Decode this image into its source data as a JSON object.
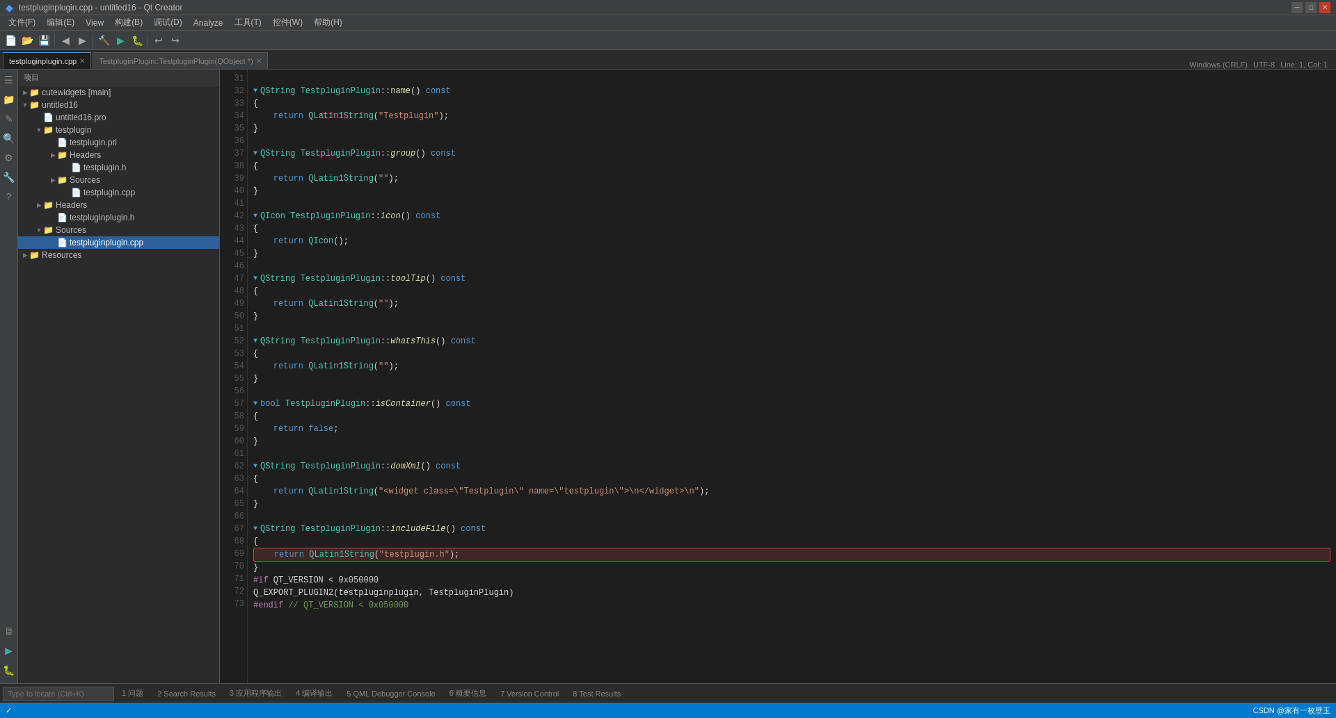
{
  "titlebar": {
    "title": "testpluginplugin.cpp - untitled16 - Qt Creator",
    "controls": [
      "—",
      "□",
      "✕"
    ]
  },
  "menubar": {
    "items": [
      "文件(F)",
      "编辑(E)",
      "View",
      "构建(B)",
      "调试(D)",
      "Analyze",
      "工具(T)",
      "控件(W)",
      "帮助(H)"
    ]
  },
  "tabs": {
    "active_tab": "testpluginplugin.cpp",
    "tabs": [
      {
        "label": "testpluginplugin.cpp",
        "active": true
      },
      {
        "label": "TestpluginPlugin::TestpluginPlugin(QObject *)",
        "active": false
      }
    ],
    "right_info": "Windows (CRLF)",
    "line_col": "Line: 1, Col: 1"
  },
  "project_tree": {
    "header": "项目",
    "items": [
      {
        "level": 0,
        "arrow": "▶",
        "icon": "folder",
        "label": "cutewidgets [main]"
      },
      {
        "level": 0,
        "arrow": "▼",
        "icon": "folder",
        "label": "untitled16"
      },
      {
        "level": 1,
        "arrow": "",
        "icon": "file-pro",
        "label": "untitled16.pro"
      },
      {
        "level": 1,
        "arrow": "▼",
        "icon": "folder",
        "label": "testplugin"
      },
      {
        "level": 2,
        "arrow": "",
        "icon": "file-pri",
        "label": "testplugin.pri"
      },
      {
        "level": 2,
        "arrow": "▶",
        "icon": "folder",
        "label": "Headers"
      },
      {
        "level": 3,
        "arrow": "",
        "icon": "file-h",
        "label": "testplugin.h"
      },
      {
        "level": 2,
        "arrow": "▶",
        "icon": "folder",
        "label": "Sources"
      },
      {
        "level": 3,
        "arrow": "",
        "icon": "file-cpp",
        "label": "testplugin.cpp"
      },
      {
        "level": 1,
        "arrow": "▶",
        "icon": "folder",
        "label": "Headers"
      },
      {
        "level": 2,
        "arrow": "",
        "icon": "file-h",
        "label": "testpluginplugin.h"
      },
      {
        "level": 1,
        "arrow": "▼",
        "icon": "folder",
        "label": "Sources"
      },
      {
        "level": 2,
        "arrow": "",
        "icon": "file-cpp",
        "label": "testpluginplugin.cpp",
        "selected": true
      },
      {
        "level": 0,
        "arrow": "▶",
        "icon": "folder",
        "label": "Resources"
      }
    ]
  },
  "code": {
    "lines": [
      {
        "num": 31,
        "content": ""
      },
      {
        "num": 32,
        "content": "QString TestpluginPlugin::<b>name</b>() const",
        "has_arrow": true
      },
      {
        "num": 33,
        "content": "{"
      },
      {
        "num": 34,
        "content": "    return QLatin1String(\"Testplugin\");"
      },
      {
        "num": 35,
        "content": "}"
      },
      {
        "num": 36,
        "content": ""
      },
      {
        "num": 37,
        "content": "QString TestpluginPlugin::<i><b>group</b></i>() const",
        "has_arrow": true
      },
      {
        "num": 38,
        "content": "{"
      },
      {
        "num": 39,
        "content": "    return QLatin1String(\"\");"
      },
      {
        "num": 40,
        "content": "}"
      },
      {
        "num": 41,
        "content": ""
      },
      {
        "num": 42,
        "content": "QIcon TestpluginPlugin::<i><b>icon</b></i>() const",
        "has_arrow": true
      },
      {
        "num": 43,
        "content": "{"
      },
      {
        "num": 44,
        "content": "    return QIcon();"
      },
      {
        "num": 45,
        "content": "}"
      },
      {
        "num": 46,
        "content": ""
      },
      {
        "num": 47,
        "content": "QString TestpluginPlugin::<i><b>toolTip</b></i>() const",
        "has_arrow": true
      },
      {
        "num": 48,
        "content": "{"
      },
      {
        "num": 49,
        "content": "    return QLatin1String(\"\");"
      },
      {
        "num": 50,
        "content": "}"
      },
      {
        "num": 51,
        "content": ""
      },
      {
        "num": 52,
        "content": "QString TestpluginPlugin::<i><b>whatsThis</b></i>() const",
        "has_arrow": true
      },
      {
        "num": 53,
        "content": "{"
      },
      {
        "num": 54,
        "content": "    return QLatin1String(\"\");"
      },
      {
        "num": 55,
        "content": "}"
      },
      {
        "num": 56,
        "content": ""
      },
      {
        "num": 57,
        "content": "bool TestpluginPlugin::<i><b>isContainer</b></i>() const",
        "has_arrow": true
      },
      {
        "num": 58,
        "content": "{"
      },
      {
        "num": 59,
        "content": "    return false;"
      },
      {
        "num": 60,
        "content": "}"
      },
      {
        "num": 61,
        "content": ""
      },
      {
        "num": 62,
        "content": "QString TestpluginPlugin::<i><b>domXml</b></i>() const",
        "has_arrow": true
      },
      {
        "num": 63,
        "content": "{"
      },
      {
        "num": 64,
        "content": "    return QLatin1String(\"<widget class=\\\"Testplugin\\\" name=\\\"testplugin\\\">\\n</widget>\\n\");"
      },
      {
        "num": 65,
        "content": "}"
      },
      {
        "num": 66,
        "content": ""
      },
      {
        "num": 67,
        "content": "QString TestpluginPlugin::<i><b>includeFile</b></i>() const",
        "has_arrow": true
      },
      {
        "num": 68,
        "content": "{"
      },
      {
        "num": 69,
        "content": "    return QLatin1String(\"testplugin.h\");",
        "highlighted": true
      },
      {
        "num": 70,
        "content": "}"
      },
      {
        "num": 71,
        "content": "#if QT_VERSION < 0x050000"
      },
      {
        "num": 72,
        "content": "Q_EXPORT_PLUGIN2(testpluginplugin, TestpluginPlugin)"
      },
      {
        "num": 73,
        "content": "#endif // QT_VERSION < 0x050000"
      }
    ]
  },
  "bottom_tabs": [
    {
      "label": "1 问题",
      "badge": null
    },
    {
      "label": "2 Search Results",
      "badge": null
    },
    {
      "label": "3 应用程序输出",
      "badge": null
    },
    {
      "label": "4 编译输出",
      "badge": null
    },
    {
      "label": "5 QML Debugger Console",
      "badge": null
    },
    {
      "label": "6 概要信息",
      "badge": null
    },
    {
      "label": "7 Version Control",
      "badge": null
    },
    {
      "label": "8 Test Results",
      "badge": null
    }
  ],
  "status_bar": {
    "right_text": "CSDN @家有一枚壁玉",
    "encoding": "UTF-8"
  },
  "sidebar_icons": [
    "≡",
    "📁",
    "✎",
    "🔍",
    "⚙",
    "🔧",
    "?"
  ],
  "search_placeholder": "Type to locate (Ctrl+K)"
}
